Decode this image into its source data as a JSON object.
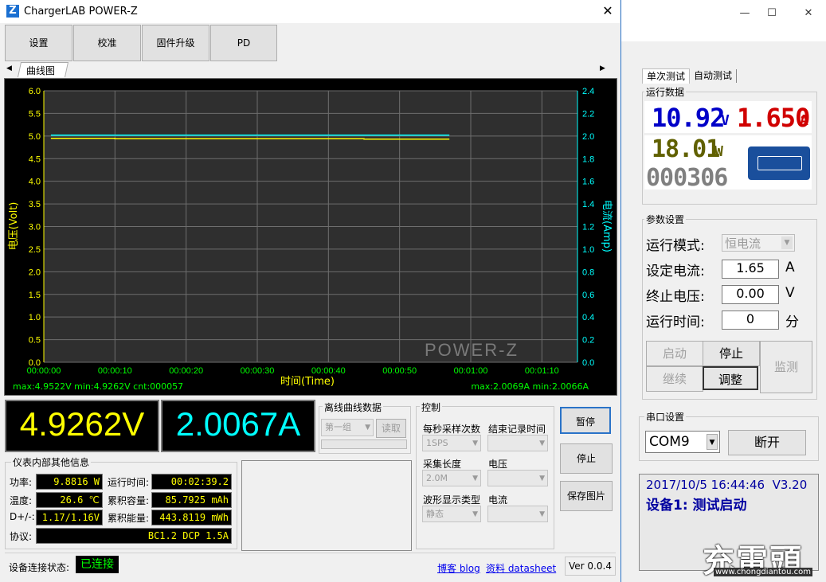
{
  "main_window": {
    "title": "ChargerLAB POWER-Z",
    "toolbar": [
      "设置",
      "校准",
      "固件升级",
      "PD"
    ],
    "tab_label": "曲线图",
    "readout": {
      "voltage": "4.9262V",
      "current": "2.0067A"
    },
    "offline": {
      "title": "离线曲线数据",
      "group": "第一组",
      "read_button": "读取"
    },
    "control": {
      "title": "控制",
      "sample_rate_label": "每秒采样次数",
      "sample_rate_value": "1SPS",
      "end_time_label": "结束记录时间",
      "end_time_value": "",
      "length_label": "采集长度",
      "length_value": "2.0M",
      "voltage_label": "电压",
      "voltage_value": "",
      "wave_type_label": "波形显示类型",
      "wave_type_value": "静态",
      "current_label": "电流",
      "current_value": ""
    },
    "buttons": {
      "pause": "暂停",
      "stop": "停止",
      "save": "保存图片"
    },
    "info": {
      "title": "仪表内部其他信息",
      "power_label": "功率:",
      "power": "9.8816 W",
      "runtime_label": "运行时间:",
      "runtime": "00:02:39.2",
      "temp_label": "温度:",
      "temp": "26.6 ℃",
      "capacity_label": "累积容量:",
      "capacity": "85.7925 mAh",
      "dpdm_label": "D+/-:",
      "dpdm": "1.17/1.16V",
      "energy_label": "累积能量:",
      "energy": "443.8119 mWh",
      "protocol_label": "协议:",
      "protocol": "BC1.2 DCP 1.5A"
    },
    "status": {
      "label": "设备连接状态:",
      "value": "已连接",
      "blog": "博客 blog",
      "datasheet": "资料 datasheet",
      "version": "Ver 0.0.4"
    },
    "colors": {
      "voltage": "#ffff00",
      "current": "#00ffff",
      "status_green": "#00ff00"
    }
  },
  "chart_data": {
    "type": "line",
    "ylabel_left": "电压(Volt)",
    "ylabel_right": "电流(Amp)",
    "xlabel": "时间(Time)",
    "watermark": "POWER-Z",
    "x_ticks": [
      "00:00:00",
      "00:00:10",
      "00:00:20",
      "00:00:30",
      "00:00:40",
      "00:00:50",
      "00:01:00",
      "00:01:10"
    ],
    "y_left_ticks": [
      "0.0",
      "0.5",
      "1.0",
      "1.5",
      "2.0",
      "2.5",
      "3.0",
      "3.5",
      "4.0",
      "4.5",
      "5.0",
      "5.5",
      "6.0"
    ],
    "y_right_ticks": [
      "0.0",
      "0.2",
      "0.4",
      "0.6",
      "0.8",
      "1.0",
      "1.2",
      "1.4",
      "1.6",
      "1.8",
      "2.0",
      "2.2",
      "2.4"
    ],
    "y_left_range": [
      0,
      6
    ],
    "y_right_range": [
      0,
      2.4
    ],
    "x_range_seconds": [
      0,
      75
    ],
    "series": [
      {
        "axis": "left",
        "color": "#ffff00",
        "x": [
          1,
          10,
          10,
          45,
          45,
          57
        ],
        "values": [
          4.95,
          4.95,
          4.94,
          4.94,
          4.93,
          4.93
        ]
      },
      {
        "axis": "right",
        "color": "#00ffff",
        "x": [
          1,
          57
        ],
        "values": [
          2.007,
          2.007
        ]
      }
    ],
    "stats_left": "max:4.9522V min:4.9262V cnt:000057",
    "stats_right": "max:2.0069A min:2.0066A"
  },
  "bg_app": {
    "tabs": [
      "单次测试",
      "自动测试"
    ],
    "run_data_title": "运行数据",
    "voltage": "10.92",
    "voltage_unit": "V",
    "current": "1.650",
    "current_unit": "A",
    "power": "18.01",
    "power_unit": "W",
    "time": "000306",
    "param_title": "参数设置",
    "mode_label": "运行模式:",
    "mode_value": "恒电流",
    "set_current_label": "设定电流:",
    "set_current_value": "1.65",
    "set_current_unit": "A",
    "end_voltage_label": "终止电压:",
    "end_voltage_value": "0.00",
    "end_voltage_unit": "V",
    "run_time_label": "运行时间:",
    "run_time_value": "0",
    "run_time_unit": "分",
    "btn_start": "启动",
    "btn_stop": "停止",
    "btn_monitor": "监测",
    "btn_continue": "继续",
    "btn_adjust": "调整",
    "serial_title": "串口设置",
    "port": "COM9",
    "disconnect": "断开",
    "log_line1": "2017/10/5 16:44:46  V3.20",
    "log_line2": "设备1: 测试启动",
    "site": "www.chongdiantou.com",
    "colors": {
      "voltage": "#0000c8",
      "current": "#d00000",
      "power": "#606000",
      "log_blue": "#0000a0"
    }
  }
}
